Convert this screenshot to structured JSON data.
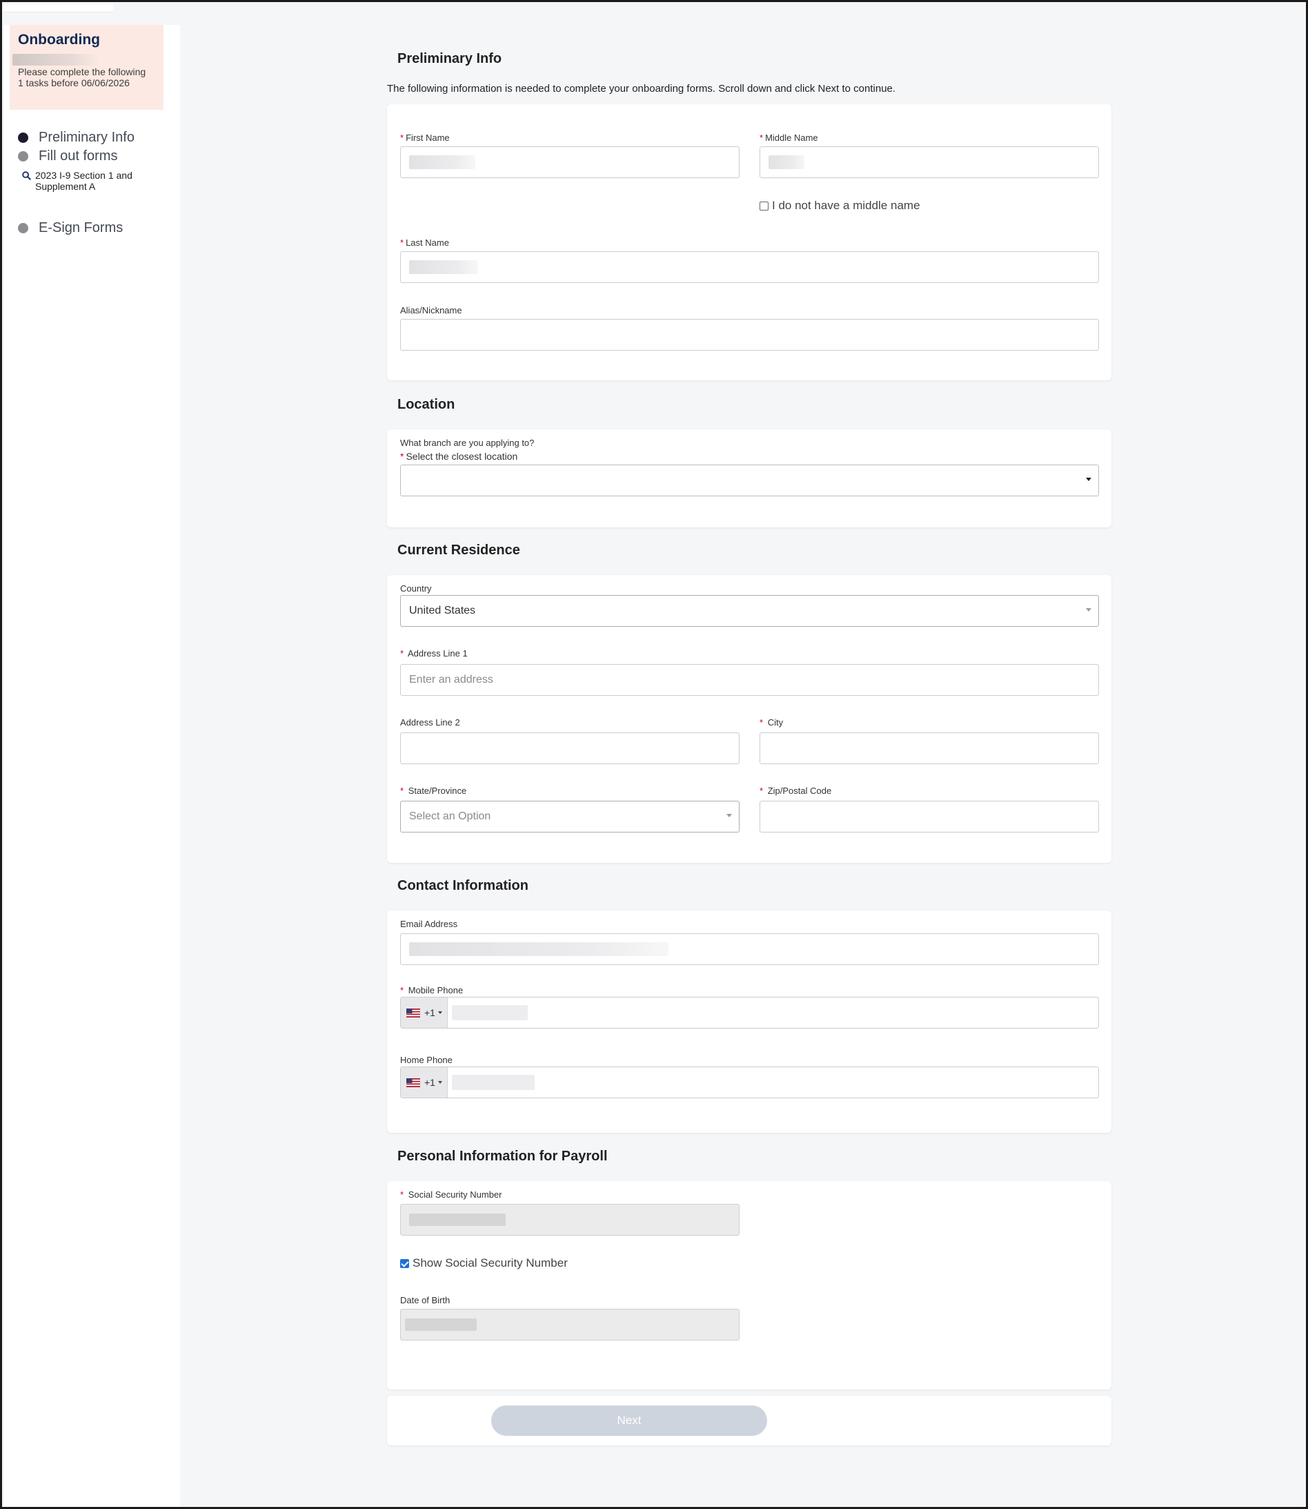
{
  "sidebar": {
    "title": "Onboarding",
    "notice": "Please complete the following 1 tasks before 06/06/2026",
    "steps": [
      {
        "label": "Preliminary Info",
        "active": true
      },
      {
        "label": "Fill out forms",
        "active": false
      },
      {
        "label": "E-Sign Forms",
        "active": false
      }
    ],
    "subtask": {
      "icon": "search-icon",
      "label": "2023 I-9 Section 1 and Supplement A"
    }
  },
  "preliminary": {
    "title": "Preliminary Info",
    "intro": "The following information is needed to complete your onboarding forms. Scroll down and click Next to continue.",
    "first_name_label": "First Name",
    "middle_name_label": "Middle Name",
    "no_middle_name": "I do not have a middle name",
    "last_name_label": "Last Name",
    "alias_label": "Alias/Nickname"
  },
  "location": {
    "title": "Location",
    "question": "What branch are you applying to?",
    "select_label": "Select the closest location"
  },
  "residence": {
    "title": "Current Residence",
    "country_label": "Country",
    "country_value": "United States",
    "address1_label": "Address Line 1",
    "address1_placeholder": "Enter an address",
    "address2_label": "Address Line 2",
    "city_label": "City",
    "state_label": "State/Province",
    "state_placeholder": "Select an Option",
    "zip_label": "Zip/Postal Code"
  },
  "contact": {
    "title": "Contact Information",
    "email_label": "Email Address",
    "mobile_label": "Mobile Phone",
    "home_label": "Home Phone",
    "dial_code": "+1",
    "flag_icon": "us-flag-icon"
  },
  "payroll": {
    "title": "Personal Information for Payroll",
    "ssn_label": "Social Security Number",
    "show_ssn": "Show Social Security Number",
    "show_ssn_checked": true,
    "dob_label": "Date of Birth"
  },
  "actions": {
    "next_label": "Next"
  },
  "colors": {
    "brand_navy": "#102a55",
    "notice_bg": "#fde9e3",
    "required": "#d0021b",
    "next_disabled": "#cdd4dd"
  }
}
